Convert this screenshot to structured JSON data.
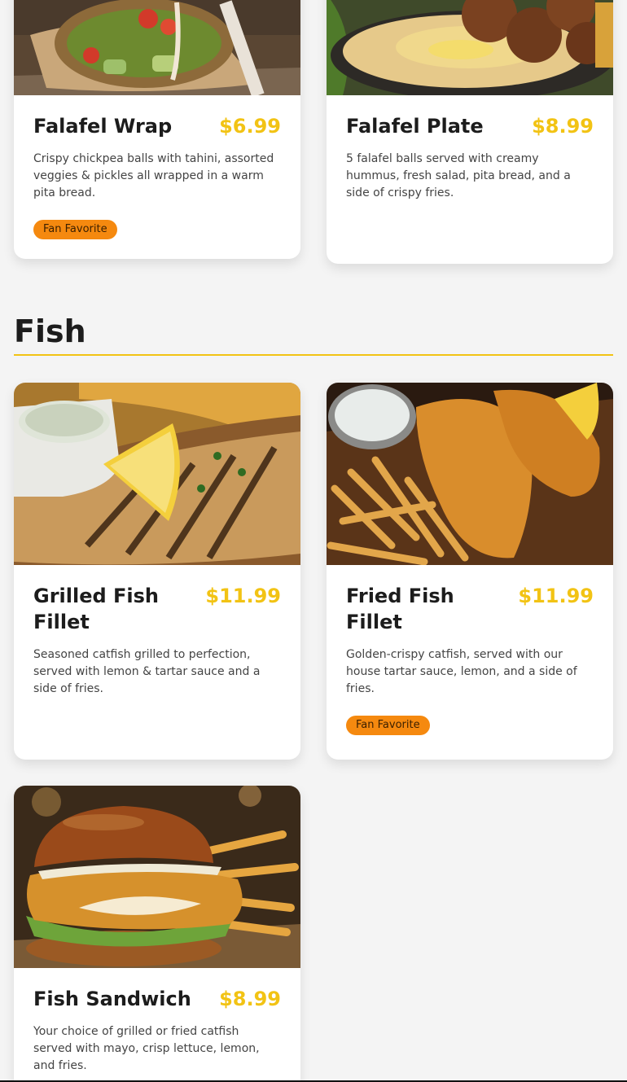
{
  "accent_color": "#f2c314",
  "badge_color": "#f5890f",
  "top_row": [
    {
      "title": "Falafel Wrap",
      "price": "$6.99",
      "description": "Crispy chickpea balls with tahini, assorted veggies & pickles all wrapped in a warm pita bread.",
      "badge": "Fan Favorite",
      "image": "falafel-wrap-photo"
    },
    {
      "title": "Falafel Plate",
      "price": "$8.99",
      "description": "5 falafel balls served with creamy hummus, fresh salad, pita bread, and a side of crispy fries.",
      "image": "falafel-plate-photo"
    }
  ],
  "fish_section": {
    "heading": "Fish",
    "items": [
      {
        "title": "Grilled Fish Fillet",
        "price": "$11.99",
        "description": "Seasoned catfish grilled to perfection, served with lemon & tartar sauce and a side of fries.",
        "image": "grilled-fish-photo"
      },
      {
        "title": "Fried Fish Fillet",
        "price": "$11.99",
        "description": "Golden-crispy catfish, served with our house tartar sauce, lemon, and a side of fries.",
        "badge": "Fan Favorite",
        "image": "fried-fish-photo"
      },
      {
        "title": "Fish Sandwich",
        "price": "$8.99",
        "description": "Your choice of grilled or fried catfish served with mayo, crisp lettuce, lemon, and fries.",
        "image": "fish-sandwich-photo"
      }
    ]
  }
}
